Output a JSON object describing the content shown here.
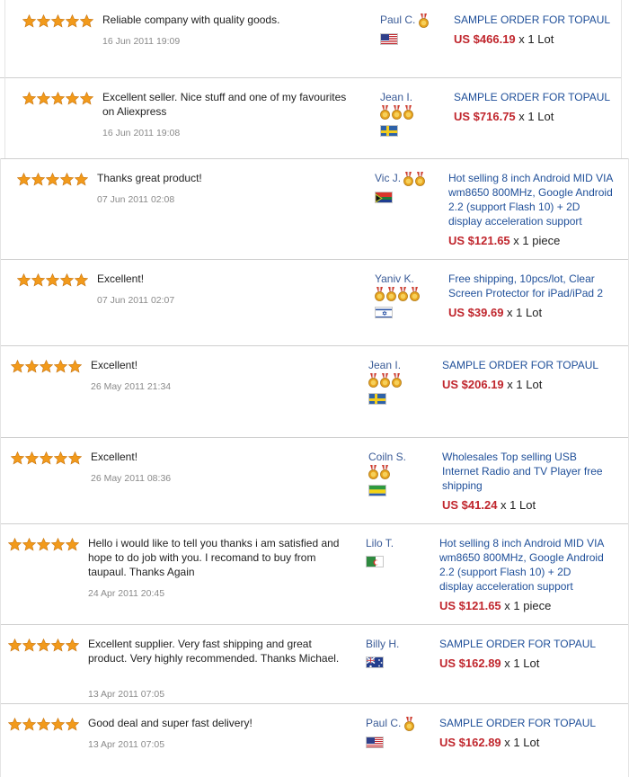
{
  "colors": {
    "star": "#f29a1b",
    "price": "#c0262d",
    "link": "#1f4f99"
  },
  "icons": {
    "star": "star-icon",
    "medal": "medal-icon",
    "flag": "country-flag-icon"
  },
  "feedback": [
    {
      "rating": 5,
      "comment": "Reliable company with quality goods.",
      "date": "16 Jun 2011 19:09",
      "buyer": "Paul C.",
      "medals": 1,
      "flag": "us",
      "product": "SAMPLE ORDER FOR TOPAUL",
      "price": "US $466.19",
      "qty": "x 1 Lot"
    },
    {
      "rating": 5,
      "comment": "Excellent seller. Nice stuff and one of my favourites on Aliexpress",
      "date": "16 Jun 2011 19:08",
      "buyer": "Jean I.",
      "medals": 3,
      "flag": "se",
      "product": "SAMPLE ORDER FOR TOPAUL",
      "price": "US $716.75",
      "qty": "x 1 Lot"
    },
    {
      "rating": 5,
      "comment": "Thanks great product!",
      "date": "07 Jun 2011 02:08",
      "buyer": "Vic J.",
      "medals": 2,
      "flag": "za",
      "product": "Hot selling 8 inch Android MID VIA wm8650 800MHz, Google Android 2.2 (support Flash 10) + 2D display acceleration support",
      "price": "US $121.65",
      "qty": "x 1 piece"
    },
    {
      "rating": 5,
      "comment": "Excellent!",
      "date": "07 Jun 2011 02:07",
      "buyer": "Yaniv K.",
      "medals": 4,
      "flag": "il",
      "product": "Free shipping, 10pcs/lot, Clear Screen Protector for iPad/iPad 2",
      "price": "US $39.69",
      "qty": "x 1 Lot"
    },
    {
      "rating": 5,
      "comment": "Excellent!",
      "date": "26 May 2011 21:34",
      "buyer": "Jean I.",
      "medals": 3,
      "flag": "se",
      "product": "SAMPLE ORDER FOR TOPAUL",
      "price": "US $206.19",
      "qty": "x 1 Lot"
    },
    {
      "rating": 5,
      "comment": "Excellent!",
      "date": "26 May 2011 08:36",
      "buyer": "Coiln S.",
      "medals": 2,
      "flag": "ga",
      "product": "Wholesales Top selling USB Internet Radio and TV Player free shipping",
      "price": "US $41.24",
      "qty": "x 1 Lot"
    },
    {
      "rating": 5,
      "comment": "Hello i would like to tell you thanks i am satisfied and hope to do job with you. I recomand to buy from taupaul. Thanks Again",
      "date": "24 Apr 2011 20:45",
      "buyer": "Lilo T.",
      "medals": 0,
      "flag": "dz",
      "product": "Hot selling 8 inch Android MID VIA wm8650 800MHz, Google Android 2.2 (support Flash 10) + 2D display acceleration support",
      "price": "US $121.65",
      "qty": "x 1 piece"
    },
    {
      "rating": 5,
      "comment": "Excellent supplier. Very fast shipping and great product. Very highly recommended. Thanks Michael.",
      "date": "13 Apr 2011 07:05",
      "buyer": "Billy H.",
      "medals": 0,
      "flag": "au",
      "product": "SAMPLE ORDER FOR TOPAUL",
      "price": "US $162.89",
      "qty": "x 1 Lot"
    },
    {
      "rating": 5,
      "comment": "Good deal and super fast delivery!",
      "date": "13 Apr 2011 07:05",
      "buyer": "Paul C.",
      "medals": 1,
      "flag": "us",
      "product": "SAMPLE ORDER FOR TOPAUL",
      "price": "US $162.89",
      "qty": "x 1 Lot"
    }
  ]
}
